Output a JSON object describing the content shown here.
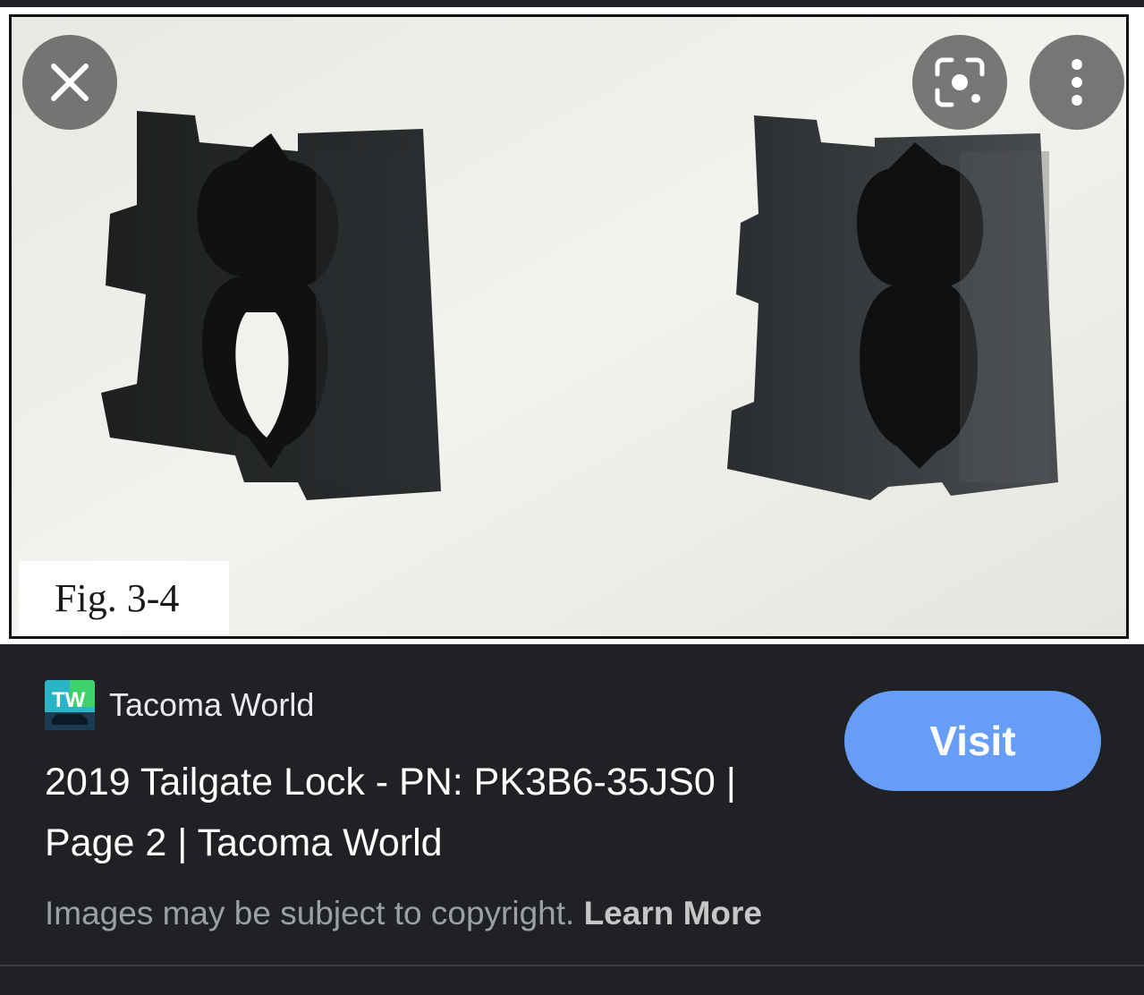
{
  "image": {
    "figure_label": "Fig. 3-4",
    "alt": "Two black plastic tailgate lock clips on a white background"
  },
  "overlay": {
    "close_icon": "close-icon",
    "lens_icon": "lens-icon",
    "more_icon": "more-vert-icon"
  },
  "source": {
    "name": "Tacoma World",
    "favicon_text": "TW",
    "favicon_color": "#2bb3c6"
  },
  "result": {
    "title": "2019 Tailgate Lock - PN: PK3B6-35JS0 | Page 2 | Tacoma World",
    "visit_label": "Visit"
  },
  "footer": {
    "copyright_text": "Images may be subject to copyright.",
    "learn_more": "Learn More"
  },
  "colors": {
    "background": "#202124",
    "visit_button": "#669df6",
    "secondary_text": "#9aa0a6"
  }
}
